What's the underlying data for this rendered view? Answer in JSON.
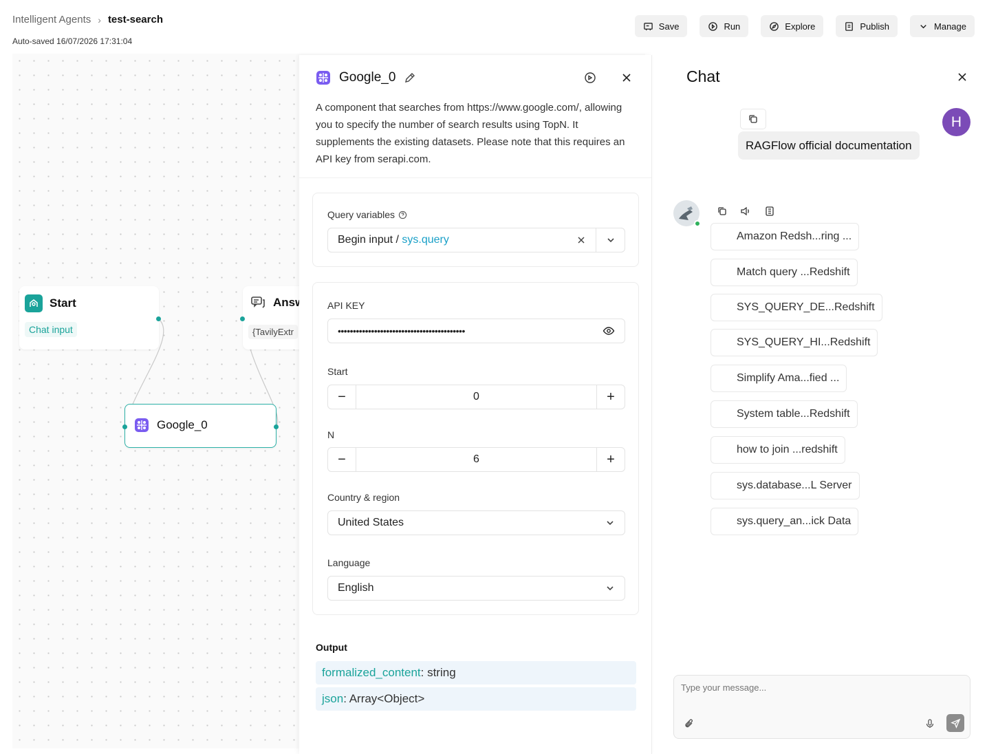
{
  "breadcrumb": {
    "parent": "Intelligent Agents",
    "separator": "›",
    "current": "test-search"
  },
  "autosaved": "Auto-saved 16/07/2026 17:31:04",
  "toolbar": {
    "save": "Save",
    "run": "Run",
    "explore": "Explore",
    "publish": "Publish",
    "manage": "Manage"
  },
  "canvas": {
    "start_node": {
      "title": "Start",
      "subtitle": "Chat input"
    },
    "answer_node": {
      "title": "Answ",
      "subtitle": "{TavilyExtr"
    },
    "google_node": {
      "title": "Google_0"
    }
  },
  "panel": {
    "title": "Google_0",
    "description": "A component that searches from https://www.google.com/, allowing you to specify the number of search results using TopN. It supplements the existing datasets. Please note that this requires an API key from serapi.com.",
    "query_label": "Query variables",
    "query_value_prefix": "Begin input / ",
    "query_value_var": "sys.query",
    "api_key_label": "API KEY",
    "api_key_value": "••••••••••••••••••••••••••••••••••••••••••",
    "start_label": "Start",
    "start_value": "0",
    "n_label": "N",
    "n_value": "6",
    "minus": "−",
    "plus": "+",
    "country_label": "Country & region",
    "country_value": "United States",
    "language_label": "Language",
    "language_value": "English",
    "output_label": "Output",
    "outputs": [
      {
        "name": "formalized_content",
        "type": ": string"
      },
      {
        "name": "json",
        "type": ": Array<Object>"
      }
    ]
  },
  "chat": {
    "title": "Chat",
    "user_message": "RAGFlow official documentation",
    "user_avatar": "H",
    "references": [
      "Amazon Redsh...ring ...",
      "Match query ...Redshift",
      "SYS_QUERY_DE...Redshift",
      "SYS_QUERY_HI...Redshift",
      "Simplify Ama...fied ...",
      "System table...Redshift",
      "how to join ...redshift",
      "sys.database...L Server",
      "sys.query_an...ick Data"
    ],
    "input_placeholder": "Type your message..."
  },
  "colors": {
    "accent": "#1aa39a",
    "variable": "#1aa0c8",
    "avatar": "#7b4bb7",
    "output_bg": "#eef5fb"
  }
}
